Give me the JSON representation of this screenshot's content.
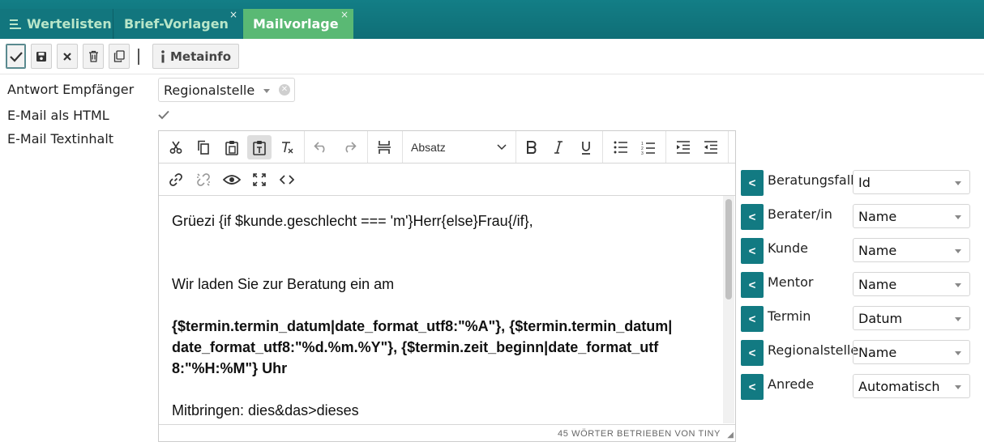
{
  "tabs": [
    {
      "label": "Wertelisten",
      "icon": "list-icon",
      "closable": false
    },
    {
      "label": "Brief-Vorlagen",
      "closable": true
    },
    {
      "label": "Mailvorlage",
      "closable": true,
      "active": true
    }
  ],
  "tab_close_glyph": "×",
  "toolbar": {
    "meta_label": "Metainfo",
    "buttons": [
      "confirm-icon",
      "save-icon",
      "close-icon",
      "trash-icon",
      "copy-icon",
      "info-icon"
    ]
  },
  "form": {
    "reply_label": "Antwort Empfänger",
    "reply_value": "Regionalstelle",
    "html_label": "E-Mail als HTML",
    "html_checked": true,
    "text_label": "E-Mail Textinhalt"
  },
  "editor": {
    "block_format": "Absatz",
    "lines": [
      "Grüezi {if $kunde.geschlecht === 'm'}Herr{else}Frau{/if},",
      "Wir laden Sie zur Beratung ein am",
      "{$termin.termin_datum|date_format_utf8:\"%A\"}, {$termin.termin_datum|",
      "date_format_utf8:\"%d.%m.%Y\"}, {$termin.zeit_beginn|date_format_utf",
      "8:\"%H:%M\"} Uhr",
      "Mitbringen: dies&das>dieses"
    ],
    "status": "45 WÖRTER  BETRIEBEN VON TINY"
  },
  "placeholders": {
    "insert_label": "<",
    "rows": [
      {
        "label": "Beratungsfall",
        "value": "Id"
      },
      {
        "label": "Berater/in",
        "value": "Name"
      },
      {
        "label": "Kunde",
        "value": "Name"
      },
      {
        "label": "Mentor",
        "value": "Name"
      },
      {
        "label": "Termin",
        "value": "Datum"
      },
      {
        "label": "Regionalstelle",
        "value": "Name"
      },
      {
        "label": "Anrede",
        "value": "Automatisch"
      }
    ]
  },
  "colors": {
    "teal": "#127a82",
    "active_tab": "#5ab974",
    "tab_text": "#b9e6c9"
  }
}
